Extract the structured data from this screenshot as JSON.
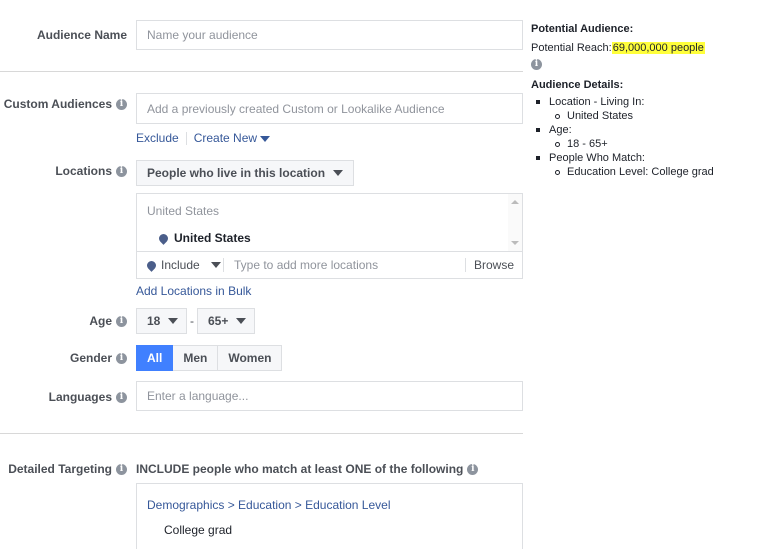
{
  "form": {
    "audience_name": {
      "label": "Audience Name",
      "placeholder": "Name your audience"
    },
    "custom_audiences": {
      "label": "Custom Audiences",
      "placeholder": "Add a previously created Custom or Lookalike Audience",
      "exclude_label": "Exclude",
      "create_new_label": "Create New"
    },
    "locations": {
      "label": "Locations",
      "type_dropdown": "People who live in this location",
      "group_header": "United States",
      "selected": [
        "United States"
      ],
      "include_dropdown": "Include",
      "placeholder": "Type to add more locations",
      "browse_label": "Browse",
      "bulk_link": "Add Locations in Bulk"
    },
    "age": {
      "label": "Age",
      "min": "18",
      "separator": "-",
      "max": "65+"
    },
    "gender": {
      "label": "Gender",
      "options": [
        "All",
        "Men",
        "Women"
      ],
      "selected": "All"
    },
    "languages": {
      "label": "Languages",
      "placeholder": "Enter a language..."
    },
    "detailed_targeting": {
      "label": "Detailed Targeting",
      "header": "INCLUDE people who match at least ONE of the following",
      "path": "Demographics > Education > Education Level",
      "items": [
        "College grad"
      ]
    }
  },
  "sidebar": {
    "potential_title": "Potential Audience:",
    "reach_label": "Potential Reach:",
    "reach_value": "69,000,000 people",
    "details_title": "Audience Details:",
    "details": [
      {
        "label": "Location - Living In:",
        "values": [
          "United States"
        ]
      },
      {
        "label": "Age:",
        "values": [
          "18 - 65+"
        ]
      },
      {
        "label": "People Who Match:",
        "values": [
          "Education Level: College grad"
        ]
      }
    ]
  },
  "icons": {
    "info": "i"
  },
  "colors": {
    "accent": "#4080ff",
    "link": "#365899",
    "highlight": "#ffff3b"
  }
}
